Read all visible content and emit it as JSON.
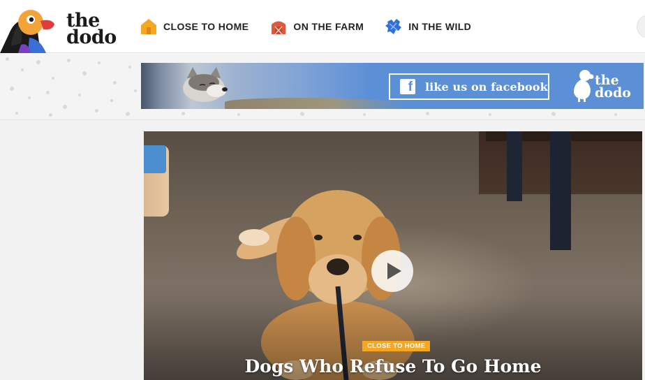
{
  "brand": {
    "name_line1": "the",
    "name_line2": "dodo"
  },
  "nav": {
    "items": [
      {
        "label": "CLOSE TO HOME",
        "icon": "house-icon",
        "color": "#f5a623"
      },
      {
        "label": "ON THE FARM",
        "icon": "barn-icon",
        "color": "#e0573a"
      },
      {
        "label": "IN THE WILD",
        "icon": "paw-icon",
        "color": "#2f6fe0"
      }
    ]
  },
  "banner": {
    "cta_label": "like us on facebook",
    "fb_glyph": "f",
    "logo_line1": "the",
    "logo_line2": "dodo",
    "background": "#5b8fd6"
  },
  "feature": {
    "tag": "CLOSE TO HOME",
    "title": "Dogs Who Refuse To Go Home",
    "tag_color": "#f5a623"
  }
}
